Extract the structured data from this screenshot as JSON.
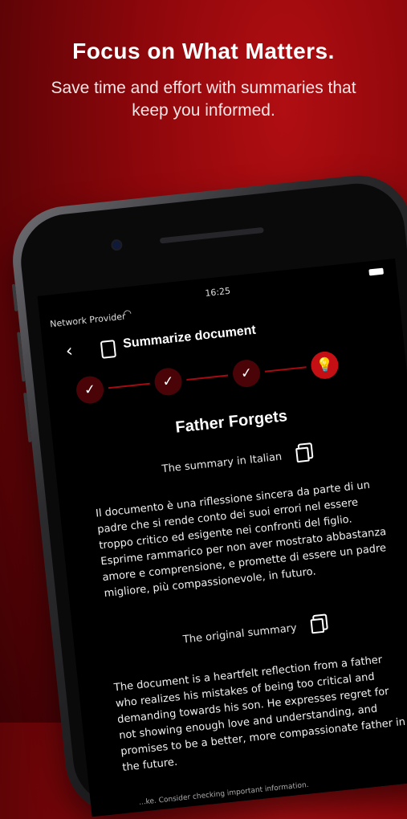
{
  "promo": {
    "headline": "Focus on What Matters.",
    "subline": "Save time and effort with summaries that keep you informed."
  },
  "statusbar": {
    "carrier": "Network Provider",
    "time": "16:25"
  },
  "navbar": {
    "title": "Summarize document",
    "back_icon": "chevron-left-icon",
    "doc_icon": "document-icon"
  },
  "stepper": {
    "steps": [
      "✓",
      "✓",
      "✓",
      "💡"
    ],
    "active_index": 3
  },
  "document": {
    "title": "Father Forgets",
    "italian_label": "The summary in Italian",
    "italian_text": "Il documento è una riflessione sincera da parte di un padre che si rende conto dei suoi errori nel essere troppo critico ed esigente nei confronti del figlio. Esprime rammarico per non aver mostrato abbastanza amore e comprensione, e promette di essere un padre migliore, più compassionevole, in futuro.",
    "original_label": "The original summary",
    "original_text": "The document is a heartfelt reflection from a father who realizes his mistakes of being too critical and demanding towards his son. He expresses regret for not showing enough love and understanding, and promises to be a better, more compassionate father in the future.",
    "footer": "...ke. Consider checking important information."
  },
  "colors": {
    "accent": "#c40f15",
    "background": "#8e070b"
  }
}
